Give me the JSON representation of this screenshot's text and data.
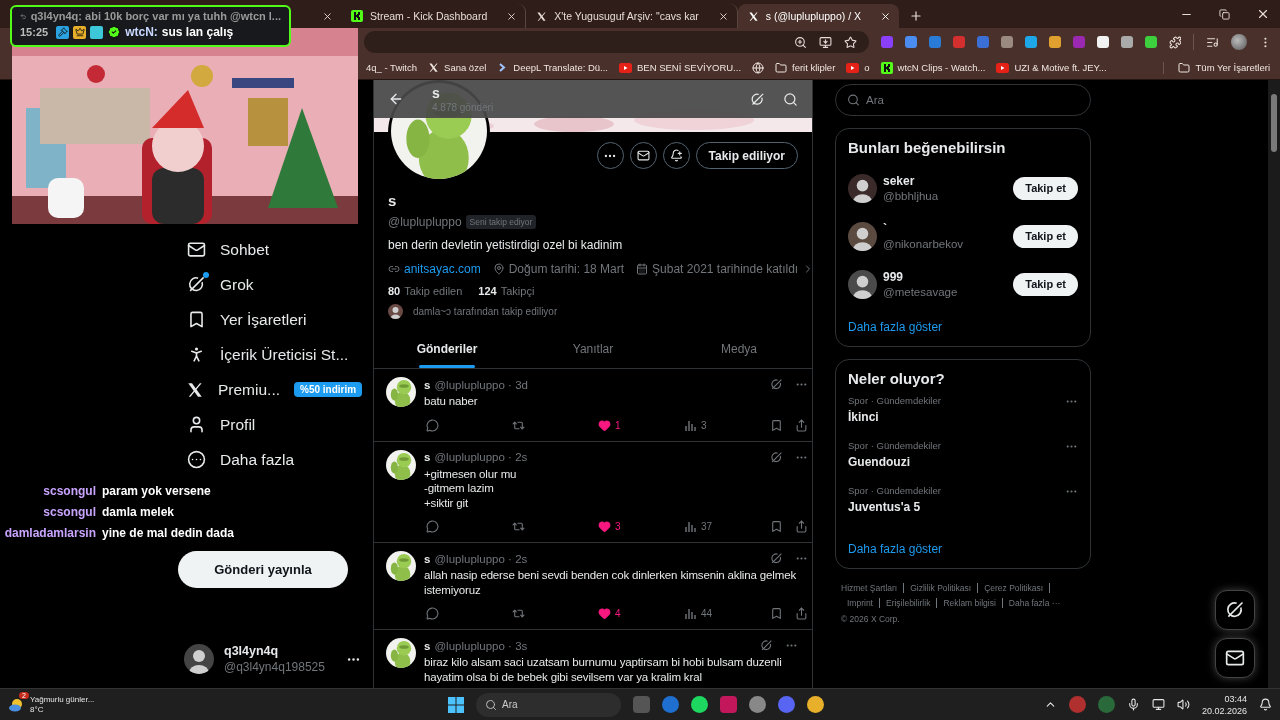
{
  "browser": {
    "tabs": [
      {
        "label": "Stream - Kick Dashboard",
        "kind": "kick",
        "selected": false
      },
      {
        "label": "X'te Yugusuguf Arşiv: \"cavs kar",
        "kind": "x",
        "selected": false
      },
      {
        "label": "s (@luplupluppo) / X",
        "kind": "x",
        "selected": true
      }
    ],
    "bookmarks": [
      {
        "label": "4q_ - Twitch",
        "kind": "plain"
      },
      {
        "label": "Sana özel",
        "kind": "x"
      },
      {
        "label": "DeepL Translate: Dü...",
        "kind": "deepl"
      },
      {
        "label": "BEN SENİ SEVİYORU...",
        "kind": "youtube"
      },
      {
        "kind": "globe"
      },
      {
        "label": "ferit klipler",
        "kind": "folder"
      },
      {
        "label": "o",
        "kind": "youtube"
      },
      {
        "label": "wtcN Clips - Watch...",
        "kind": "kick"
      },
      {
        "label": "UZI & Motive ft. JEY...",
        "kind": "youtube"
      }
    ],
    "all_bookmarks": "Tüm Yer İşaretleri"
  },
  "stream_overlay": {
    "pinned_chat": {
      "reply_text": "q3l4yn4q: abi 10k borç var mı ya tuhh @wtcn l...",
      "time": "15:25",
      "user": "wtcN:",
      "message": "sus lan çalış"
    },
    "chat": [
      {
        "user": "scsongul",
        "message": "param yok versene"
      },
      {
        "user": "scsongul",
        "message": "damla melek"
      },
      {
        "user": "damladamlarsin",
        "message": "yine de mal dedin dada"
      }
    ]
  },
  "sidebar": {
    "items": [
      {
        "label": "Sohbet",
        "kind": "mail",
        "notification": false
      },
      {
        "label": "Grok",
        "kind": "grok",
        "notification": true
      },
      {
        "label": "Yer İşaretleri",
        "kind": "bookmark",
        "notification": false
      },
      {
        "label": "İçerik Üreticisi St...",
        "kind": "creator",
        "notification": false
      },
      {
        "label": "Premiu...",
        "kind": "x",
        "notification": false,
        "badge": "%50 indirim"
      },
      {
        "label": "Profil",
        "kind": "user",
        "notification": false
      },
      {
        "label": "Daha fazla",
        "kind": "more",
        "notification": false
      }
    ],
    "post_button": "Gönderi yayınla",
    "account": {
      "name": "q3l4yn4q",
      "handle": "@q3l4yn4q198525"
    }
  },
  "profile": {
    "header_title": "s",
    "posts_count": "4.878 gönderi",
    "follow_button": "Takip ediliyor",
    "name": "s",
    "handle": "@luplupluppo",
    "follows_you": "Seni takip ediyor",
    "bio": "ben derin devletin yetistirdigi ozel bi kadinim",
    "website": "anitsayac.com",
    "birthday": "Doğum tarihi: 18 Mart",
    "joined": "Şubat 2021 tarihinde katıldı",
    "following": {
      "count": "80",
      "label": "Takip edilen"
    },
    "followers": {
      "count": "124",
      "label": "Takipçi"
    },
    "followed_by": "damla~ɔ tarafından takip ediliyor",
    "tabs": [
      {
        "label": "Gönderiler",
        "selected": true
      },
      {
        "label": "Yanıtlar",
        "selected": false
      },
      {
        "label": "Medya",
        "selected": false
      }
    ]
  },
  "tweets": [
    {
      "name": "s",
      "meta": "@luplupluppo · 3d",
      "lines": [
        "batu naber"
      ],
      "liked": true,
      "likes": "1",
      "views": "3"
    },
    {
      "name": "s",
      "meta": "@luplupluppo · 2s",
      "lines": [
        "+gitmesen olur mu",
        "-gitmem lazim",
        "+siktir git"
      ],
      "liked": true,
      "likes": "3",
      "views": "37"
    },
    {
      "name": "s",
      "meta": "@luplupluppo · 2s",
      "lines": [
        "allah nasip ederse beni sevdi benden cok dinlerken kimsenin aklina gelmek istemiyoruz"
      ],
      "liked": true,
      "likes": "4",
      "views": "44"
    },
    {
      "name": "s",
      "meta": "@luplupluppo · 3s",
      "lines": [
        "biraz kilo alsam saci uzatsam burnumu yaptirsam bi hobi bulsam duzenli hayatim olsa bi de bebek gibi sevilsem var ya kralim kral"
      ]
    }
  ],
  "right": {
    "search_placeholder": "Ara",
    "suggestions": {
      "title": "Bunları beğenebilirsin",
      "users": [
        {
          "name": "seker",
          "handle": "@bbhljhua",
          "button": "Takip et"
        },
        {
          "name": "`",
          "handle": "@nikonarbekov",
          "button": "Takip et"
        },
        {
          "name": "999",
          "handle": "@metesavage",
          "button": "Takip et"
        }
      ],
      "show_more": "Daha fazla göster"
    },
    "trends": {
      "title": "Neler oluyor?",
      "items": [
        {
          "context": "Spor · Gündemdekiler",
          "title": "İkinci"
        },
        {
          "context": "Spor · Gündemdekiler",
          "title": "Guendouzi"
        },
        {
          "context": "Spor · Gündemdekiler",
          "title": "Juventus'a 5"
        }
      ],
      "show_more": "Daha fazla göster"
    },
    "footer_links": [
      "Hizmet Şartları",
      "Gizlilik Politikası",
      "Çerez Politikası",
      "Imprint",
      "Erişilebilirlik",
      "Reklam bilgisi",
      "Daha fazla ···"
    ],
    "copyright": "© 2026 X Corp."
  },
  "taskbar": {
    "weather": {
      "badge": "2",
      "text": "Yağmurlu günler...",
      "temp": "8°C"
    },
    "search_placeholder": "Ara",
    "time": "03:44",
    "date": "20.02.2026"
  }
}
